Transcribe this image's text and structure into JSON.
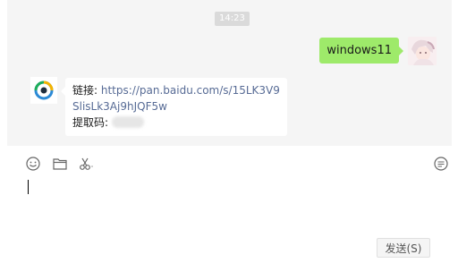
{
  "chat": {
    "timestamp": "14:23",
    "messages": [
      {
        "side": "right",
        "text": "windows11"
      },
      {
        "side": "left",
        "link_label": "链接:",
        "link_text": "https://pan.baidu.com/s/15LK3V9SlisLk3Aj9hJQF5w",
        "code_label": "提取码:"
      }
    ]
  },
  "composer": {
    "tools": [
      "emoji-icon",
      "folder-icon",
      "scissors-icon"
    ],
    "right_tool": "chat-history-icon",
    "send_label": "发送(S)"
  },
  "colors": {
    "bubble_green": "#9eea6a",
    "link": "#576b95",
    "chat_bg": "#f5f5f5"
  }
}
